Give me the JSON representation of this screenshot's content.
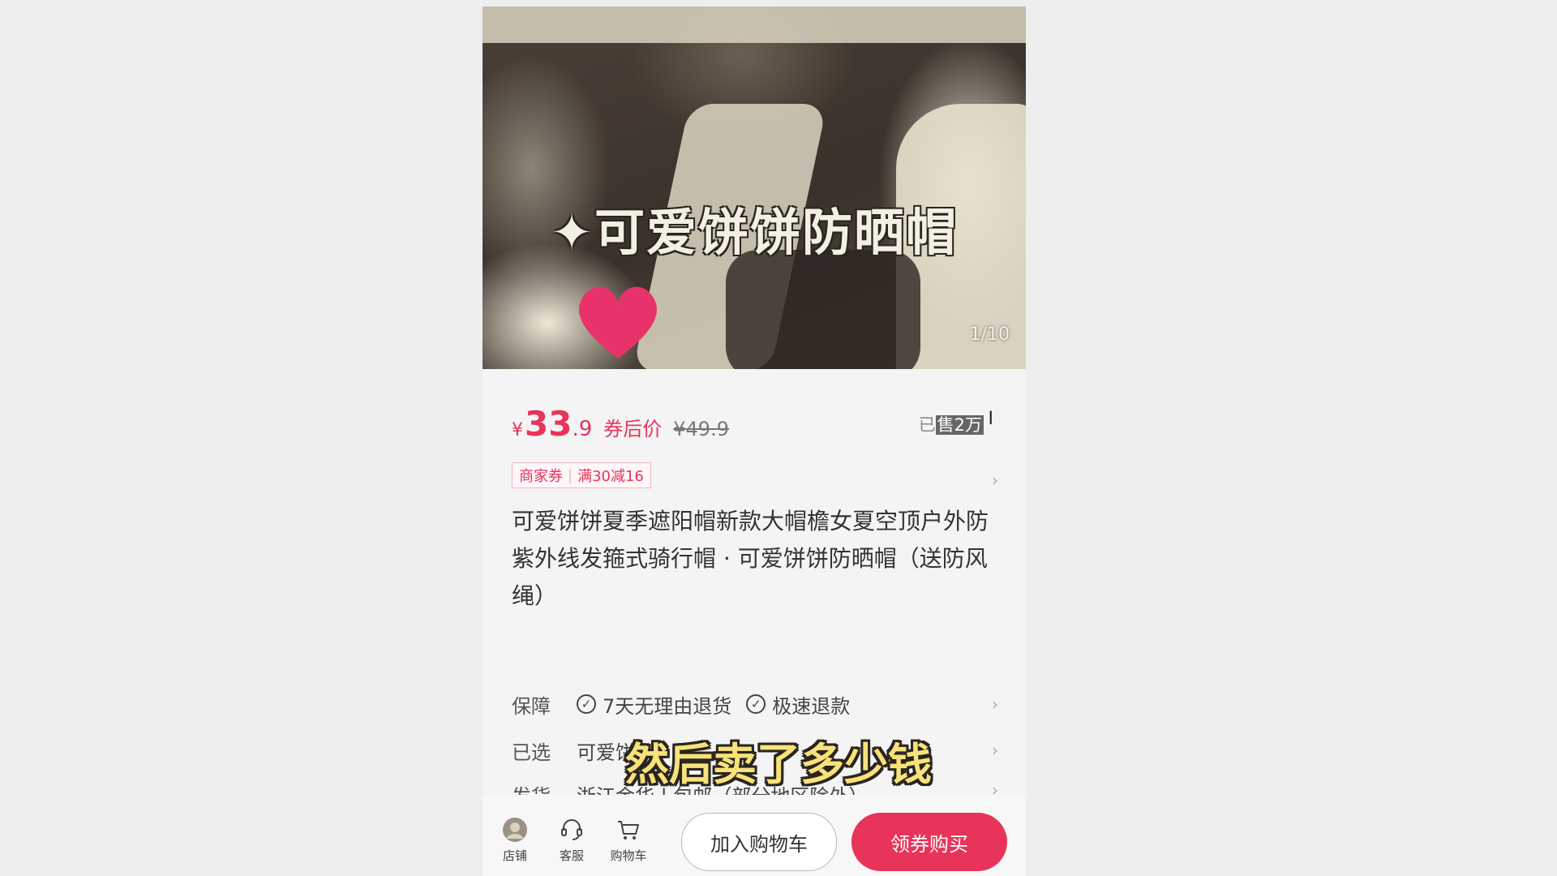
{
  "hero": {
    "title": "✦可爱饼饼防晒帽",
    "counter": "1/10"
  },
  "price": {
    "currency": "¥",
    "integer": "33",
    "decimal": ".9",
    "label": "券后价",
    "original": "¥49.9"
  },
  "sold": {
    "prefix": "已",
    "highlighted": "售2万"
  },
  "coupon": {
    "type": "商家券",
    "rule": "满30减16"
  },
  "product_title": "可爱饼饼夏季遮阳帽新款大帽檐女夏空顶户外防紫外线发箍式骑行帽 · 可爱饼饼防晒帽（送防风绳）",
  "attributes": {
    "guarantee": {
      "key": "保障",
      "items": [
        "7天无理由退货",
        "极速退款"
      ]
    },
    "selected": {
      "key": "已选",
      "value": "可爱饼"
    },
    "shipping": {
      "key": "发货",
      "value": "浙江金华 | 包邮（部分地区除外）"
    }
  },
  "subtitle": "然后卖了多少钱",
  "bottom_bar": {
    "store": "店铺",
    "service": "客服",
    "cart": "购物车",
    "add_to_cart": "加入购物车",
    "buy": "领券购买"
  },
  "colors": {
    "accent": "#e8335a",
    "subtitle": "#f7e27a"
  }
}
